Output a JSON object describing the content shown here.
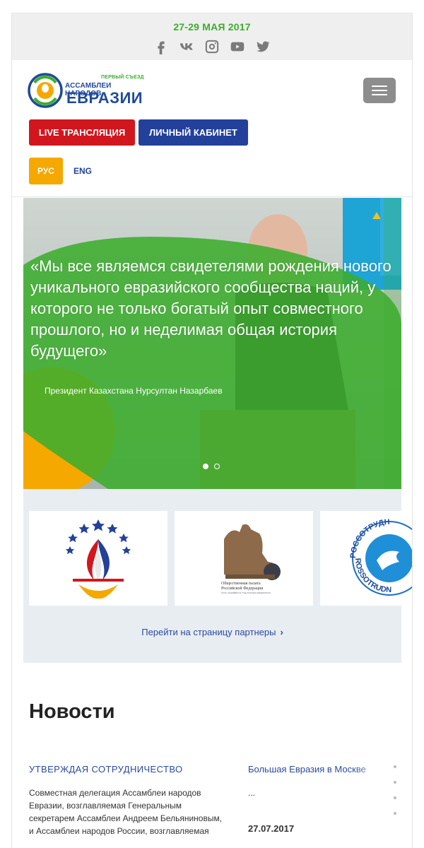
{
  "topbar": {
    "event_date": "27-29 МАЯ 2017",
    "social_icons": [
      "facebook-icon",
      "vk-icon",
      "instagram-icon",
      "youtube-icon",
      "twitter-icon"
    ]
  },
  "header": {
    "logo": {
      "small": "ПЕРВЫЙ СЪЕЗД",
      "mid": "АССАМБЛЕИ НАРОДОВ",
      "big": "ЕВРАЗИИ"
    },
    "live_label": "LIVE ТРАНСЛЯЦИЯ",
    "cabinet_label": "ЛИЧНЫЙ КАБИНЕТ",
    "lang_ru": "РУС",
    "lang_en": "ENG"
  },
  "hero": {
    "quote": "«Мы все являемся свидетелями рождения нового уникального евразийского сообщества наций, у которого не только богатый опыт совместного прошлого, но и неделимая общая история будущего»",
    "author": "Президент Казахстана Нурсултан Назарбаев",
    "slides": 2,
    "active_slide": 1
  },
  "partners": {
    "card3_text_top": "РОССОТРУДН",
    "card3_text_bottom": "ROSSOTRUDN",
    "link_label": "Перейти на страницу партнеры"
  },
  "news": {
    "title": "Новости",
    "item1": {
      "title": "УТВЕРЖДАЯ СОТРУДНИЧЕСТВО",
      "text": "Совместная делегация Ассамблеи народов Евразии, возглавляемая Генеральным секретарем Ассамблеи Андреем Бельяниновым, и Ассамблеи народов России, возглавляемая"
    },
    "item2": {
      "title": "Большая Евразия в Москве",
      "text": "...",
      "date": "27.07.2017"
    }
  },
  "colors": {
    "green": "#3cad2d",
    "blue": "#23419a",
    "red": "#d2161d",
    "orange": "#f5a800"
  }
}
